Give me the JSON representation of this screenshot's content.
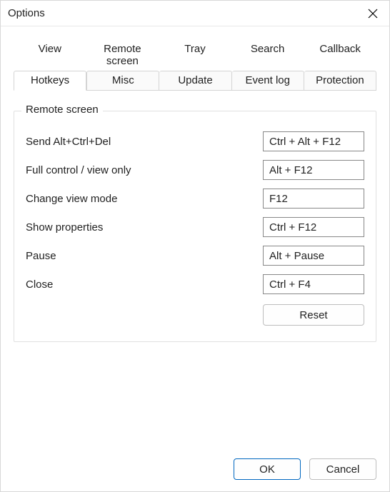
{
  "window": {
    "title": "Options"
  },
  "tabs": {
    "row1": [
      "View",
      "Remote screen",
      "Tray",
      "Search",
      "Callback"
    ],
    "row2": [
      "Hotkeys",
      "Misc",
      "Update",
      "Event log",
      "Protection"
    ],
    "active": "Hotkeys"
  },
  "panel": {
    "legend": "Remote screen",
    "rows": [
      {
        "label": "Send Alt+Ctrl+Del",
        "value": "Ctrl + Alt + F12"
      },
      {
        "label": "Full control / view only",
        "value": "Alt + F12"
      },
      {
        "label": "Change view mode",
        "value": "F12"
      },
      {
        "label": "Show properties",
        "value": "Ctrl + F12"
      },
      {
        "label": "Pause",
        "value": "Alt + Pause"
      },
      {
        "label": "Close",
        "value": "Ctrl + F4"
      }
    ],
    "reset_label": "Reset"
  },
  "footer": {
    "ok_label": "OK",
    "cancel_label": "Cancel"
  }
}
